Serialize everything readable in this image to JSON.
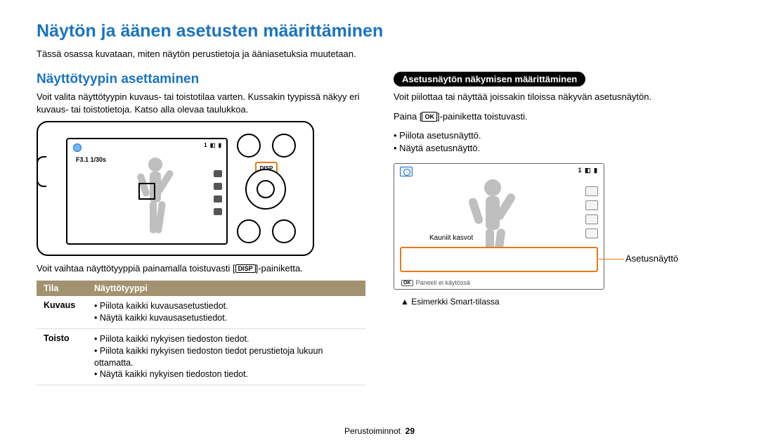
{
  "page": {
    "title": "Näytön ja äänen asetusten määrittäminen",
    "intro": "Tässä osassa kuvataan, miten näytön perustietoja ja ääniasetuksia muutetaan.",
    "footer_label": "Perustoiminnot",
    "footer_page": "29"
  },
  "left": {
    "section_title": "Näyttötyypin asettaminen",
    "section_body": "Voit valita näyttötyypin kuvaus- tai toistotilaa varten. Kussakin tyypissä näkyy eri kuvaus- tai toistotietoja. Katso alla olevaa taulukkoa.",
    "camera": {
      "f_label": "F3.1 1/30s",
      "top_row": "1 ◧ ▮",
      "disp_badge": "DISP"
    },
    "under_camera_pre": "Voit vaihtaa näyttötyyppiä painamalla toistuvasti [",
    "under_camera_disp": "DISP",
    "under_camera_post": "]-painiketta.",
    "table": {
      "headers": {
        "mode": "Tila",
        "type": "Näyttötyyppi"
      },
      "rows": [
        {
          "mode": "Kuvaus",
          "items": [
            "Piilota kaikki kuvausasetustiedot.",
            "Näytä kaikki kuvausasetustiedot."
          ]
        },
        {
          "mode": "Toisto",
          "items": [
            "Piilota kaikki nykyisen tiedoston tiedot.",
            "Piilota kaikki nykyisen tiedoston tiedot perustietoja lukuun ottamatta.",
            "Näytä kaikki nykyisen tiedoston tiedot."
          ]
        }
      ]
    }
  },
  "right": {
    "pill": "Asetusnäytön näkymisen määrittäminen",
    "body1": "Voit piilottaa tai näyttää joissakin tiloissa näkyvän asetusnäytön.",
    "press_pre": "Paina [",
    "press_ok": "OK",
    "press_post": "]-painiketta toistuvasti.",
    "list": [
      "Piilota asetusnäyttö.",
      "Näytä asetusnäyttö."
    ],
    "screen": {
      "top_row": "1 ◧ ▮",
      "center_label": "Kauniit kasvot",
      "bottom_ok": "OK",
      "bottom_text": "Paneeli ei käytössä"
    },
    "callout": "Asetusnäyttö",
    "example_caption": "▲  Esimerkki Smart-tilassa"
  }
}
